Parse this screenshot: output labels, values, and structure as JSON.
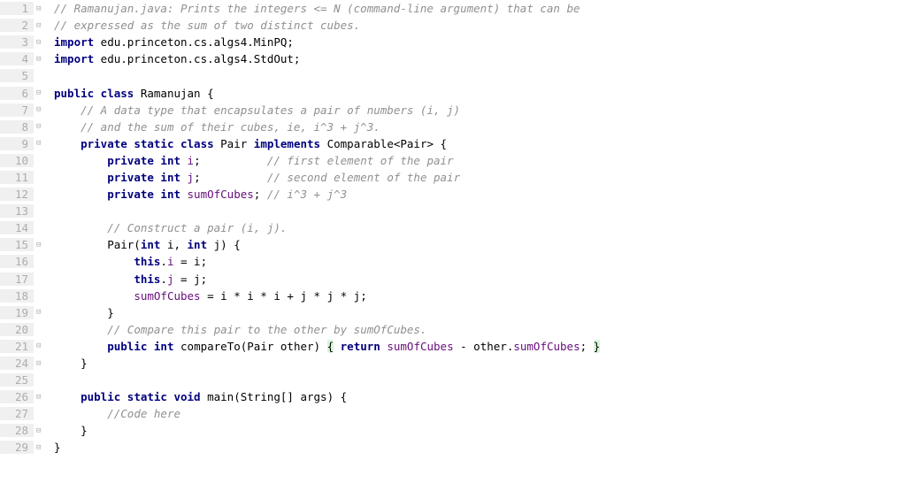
{
  "lines": [
    {
      "num": 1,
      "fold": "⊟",
      "segs": [
        [
          "c-comment",
          "// Ramanujan.java: Prints the integers <= N (command-line argument) that can be"
        ]
      ]
    },
    {
      "num": 2,
      "fold": "⊟",
      "segs": [
        [
          "c-comment",
          "// expressed as the sum of two distinct cubes."
        ]
      ]
    },
    {
      "num": 3,
      "fold": "⊟",
      "segs": [
        [
          "c-kw",
          "import"
        ],
        [
          "c-plain",
          " edu.princeton.cs.algs4.MinPQ;"
        ]
      ]
    },
    {
      "num": 4,
      "fold": "⊟",
      "segs": [
        [
          "c-kw",
          "import"
        ],
        [
          "c-plain",
          " edu.princeton.cs.algs4.StdOut;"
        ]
      ]
    },
    {
      "num": 5,
      "fold": "",
      "segs": []
    },
    {
      "num": 6,
      "fold": "⊟",
      "segs": [
        [
          "c-kw",
          "public class "
        ],
        [
          "c-plain",
          "Ramanujan {"
        ]
      ]
    },
    {
      "num": 7,
      "fold": "⊟",
      "segs": [
        [
          "c-plain",
          "    "
        ],
        [
          "c-comment",
          "// A data type that encapsulates a pair of numbers (i, j)"
        ]
      ]
    },
    {
      "num": 8,
      "fold": "⊟",
      "segs": [
        [
          "c-plain",
          "    "
        ],
        [
          "c-comment",
          "// and the sum of their cubes, ie, i^3 + j^3."
        ]
      ]
    },
    {
      "num": 9,
      "fold": "⊟",
      "segs": [
        [
          "c-plain",
          "    "
        ],
        [
          "c-kw",
          "private static class "
        ],
        [
          "c-plain",
          "Pair "
        ],
        [
          "c-kw",
          "implements"
        ],
        [
          "c-plain",
          " Comparable<Pair> {"
        ]
      ]
    },
    {
      "num": 10,
      "fold": "",
      "segs": [
        [
          "c-plain",
          "        "
        ],
        [
          "c-kw",
          "private int "
        ],
        [
          "c-field",
          "i"
        ],
        [
          "c-plain",
          ";          "
        ],
        [
          "c-comment",
          "// first element of the pair"
        ]
      ]
    },
    {
      "num": 11,
      "fold": "",
      "segs": [
        [
          "c-plain",
          "        "
        ],
        [
          "c-kw",
          "private int "
        ],
        [
          "c-field",
          "j"
        ],
        [
          "c-plain",
          ";          "
        ],
        [
          "c-comment",
          "// second element of the pair"
        ]
      ]
    },
    {
      "num": 12,
      "fold": "",
      "segs": [
        [
          "c-plain",
          "        "
        ],
        [
          "c-kw",
          "private int "
        ],
        [
          "c-field",
          "sumOfCubes"
        ],
        [
          "c-plain",
          "; "
        ],
        [
          "c-comment",
          "// i^3 + j^3"
        ]
      ]
    },
    {
      "num": 13,
      "fold": "",
      "segs": []
    },
    {
      "num": 14,
      "fold": "",
      "segs": [
        [
          "c-plain",
          "        "
        ],
        [
          "c-comment",
          "// Construct a pair (i, j)."
        ]
      ]
    },
    {
      "num": 15,
      "fold": "⊟",
      "segs": [
        [
          "c-plain",
          "        Pair("
        ],
        [
          "c-kw",
          "int"
        ],
        [
          "c-plain",
          " i, "
        ],
        [
          "c-kw",
          "int"
        ],
        [
          "c-plain",
          " j) {"
        ]
      ]
    },
    {
      "num": 16,
      "fold": "",
      "segs": [
        [
          "c-plain",
          "            "
        ],
        [
          "c-kw",
          "this"
        ],
        [
          "c-plain",
          "."
        ],
        [
          "c-field",
          "i"
        ],
        [
          "c-plain",
          " = i;"
        ]
      ]
    },
    {
      "num": 17,
      "fold": "",
      "segs": [
        [
          "c-plain",
          "            "
        ],
        [
          "c-kw",
          "this"
        ],
        [
          "c-plain",
          "."
        ],
        [
          "c-field",
          "j"
        ],
        [
          "c-plain",
          " = j;"
        ]
      ]
    },
    {
      "num": 18,
      "fold": "",
      "segs": [
        [
          "c-plain",
          "            "
        ],
        [
          "c-field",
          "sumOfCubes"
        ],
        [
          "c-plain",
          " = i * i * i + j * j * j;"
        ]
      ]
    },
    {
      "num": 19,
      "fold": "⊟",
      "segs": [
        [
          "c-plain",
          "        }"
        ]
      ]
    },
    {
      "num": 20,
      "fold": "",
      "segs": [
        [
          "c-plain",
          "        "
        ],
        [
          "c-comment",
          "// Compare this pair to the other by sumOfCubes."
        ]
      ]
    },
    {
      "num": 21,
      "fold": "⊟",
      "segs": [
        [
          "c-plain",
          "        "
        ],
        [
          "c-kw",
          "public int "
        ],
        [
          "c-plain",
          "compareTo(Pair other) "
        ],
        [
          "c-brace-hl",
          "{"
        ],
        [
          "c-plain",
          " "
        ],
        [
          "c-kw",
          "return"
        ],
        [
          "c-plain",
          " "
        ],
        [
          "c-field",
          "sumOfCubes"
        ],
        [
          "c-plain",
          " - other."
        ],
        [
          "c-field",
          "sumOfCubes"
        ],
        [
          "c-plain",
          "; "
        ],
        [
          "c-brace-hl",
          "}"
        ]
      ]
    },
    {
      "num": 24,
      "fold": "⊟",
      "segs": [
        [
          "c-plain",
          "    }"
        ]
      ]
    },
    {
      "num": 25,
      "fold": "",
      "segs": []
    },
    {
      "num": 26,
      "fold": "⊟",
      "segs": [
        [
          "c-plain",
          "    "
        ],
        [
          "c-kw",
          "public static void "
        ],
        [
          "c-plain",
          "main(String[] args) {"
        ]
      ]
    },
    {
      "num": 27,
      "fold": "",
      "segs": [
        [
          "c-plain",
          "        "
        ],
        [
          "c-comment",
          "//Code here"
        ]
      ]
    },
    {
      "num": 28,
      "fold": "⊟",
      "segs": [
        [
          "c-plain",
          "    }"
        ]
      ]
    },
    {
      "num": 29,
      "fold": "⊟",
      "segs": [
        [
          "c-plain",
          "}"
        ]
      ]
    }
  ]
}
